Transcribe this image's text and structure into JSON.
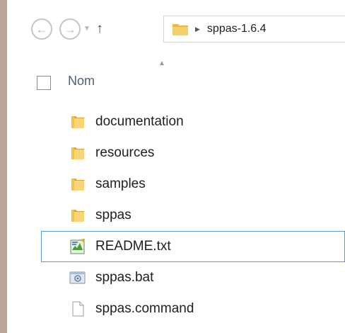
{
  "address_bar": {
    "path": "sppas-1.6.4"
  },
  "header": {
    "name_column": "Nom"
  },
  "files": [
    {
      "name": "documentation",
      "type": "folder"
    },
    {
      "name": "resources",
      "type": "folder"
    },
    {
      "name": "samples",
      "type": "folder"
    },
    {
      "name": "sppas",
      "type": "folder"
    },
    {
      "name": "README.txt",
      "type": "text-file",
      "selected": true
    },
    {
      "name": "sppas.bat",
      "type": "batch-file"
    },
    {
      "name": "sppas.command",
      "type": "generic-file"
    }
  ],
  "colors": {
    "folder": "#e8b84a",
    "selection_border": "#5a9ad9",
    "column_header": "#4c607a",
    "left_border": "#b9a898"
  }
}
